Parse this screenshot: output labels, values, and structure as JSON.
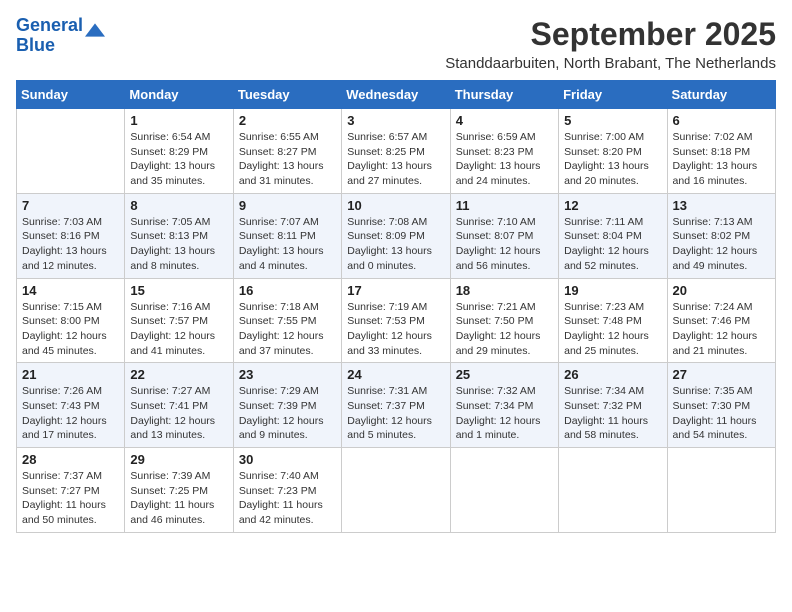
{
  "header": {
    "logo_line1": "General",
    "logo_line2": "Blue",
    "month_title": "September 2025",
    "subtitle": "Standdaarbuiten, North Brabant, The Netherlands"
  },
  "weekdays": [
    "Sunday",
    "Monday",
    "Tuesday",
    "Wednesday",
    "Thursday",
    "Friday",
    "Saturday"
  ],
  "weeks": [
    [
      {
        "day": "",
        "info": ""
      },
      {
        "day": "1",
        "info": "Sunrise: 6:54 AM\nSunset: 8:29 PM\nDaylight: 13 hours\nand 35 minutes."
      },
      {
        "day": "2",
        "info": "Sunrise: 6:55 AM\nSunset: 8:27 PM\nDaylight: 13 hours\nand 31 minutes."
      },
      {
        "day": "3",
        "info": "Sunrise: 6:57 AM\nSunset: 8:25 PM\nDaylight: 13 hours\nand 27 minutes."
      },
      {
        "day": "4",
        "info": "Sunrise: 6:59 AM\nSunset: 8:23 PM\nDaylight: 13 hours\nand 24 minutes."
      },
      {
        "day": "5",
        "info": "Sunrise: 7:00 AM\nSunset: 8:20 PM\nDaylight: 13 hours\nand 20 minutes."
      },
      {
        "day": "6",
        "info": "Sunrise: 7:02 AM\nSunset: 8:18 PM\nDaylight: 13 hours\nand 16 minutes."
      }
    ],
    [
      {
        "day": "7",
        "info": "Sunrise: 7:03 AM\nSunset: 8:16 PM\nDaylight: 13 hours\nand 12 minutes."
      },
      {
        "day": "8",
        "info": "Sunrise: 7:05 AM\nSunset: 8:13 PM\nDaylight: 13 hours\nand 8 minutes."
      },
      {
        "day": "9",
        "info": "Sunrise: 7:07 AM\nSunset: 8:11 PM\nDaylight: 13 hours\nand 4 minutes."
      },
      {
        "day": "10",
        "info": "Sunrise: 7:08 AM\nSunset: 8:09 PM\nDaylight: 13 hours\nand 0 minutes."
      },
      {
        "day": "11",
        "info": "Sunrise: 7:10 AM\nSunset: 8:07 PM\nDaylight: 12 hours\nand 56 minutes."
      },
      {
        "day": "12",
        "info": "Sunrise: 7:11 AM\nSunset: 8:04 PM\nDaylight: 12 hours\nand 52 minutes."
      },
      {
        "day": "13",
        "info": "Sunrise: 7:13 AM\nSunset: 8:02 PM\nDaylight: 12 hours\nand 49 minutes."
      }
    ],
    [
      {
        "day": "14",
        "info": "Sunrise: 7:15 AM\nSunset: 8:00 PM\nDaylight: 12 hours\nand 45 minutes."
      },
      {
        "day": "15",
        "info": "Sunrise: 7:16 AM\nSunset: 7:57 PM\nDaylight: 12 hours\nand 41 minutes."
      },
      {
        "day": "16",
        "info": "Sunrise: 7:18 AM\nSunset: 7:55 PM\nDaylight: 12 hours\nand 37 minutes."
      },
      {
        "day": "17",
        "info": "Sunrise: 7:19 AM\nSunset: 7:53 PM\nDaylight: 12 hours\nand 33 minutes."
      },
      {
        "day": "18",
        "info": "Sunrise: 7:21 AM\nSunset: 7:50 PM\nDaylight: 12 hours\nand 29 minutes."
      },
      {
        "day": "19",
        "info": "Sunrise: 7:23 AM\nSunset: 7:48 PM\nDaylight: 12 hours\nand 25 minutes."
      },
      {
        "day": "20",
        "info": "Sunrise: 7:24 AM\nSunset: 7:46 PM\nDaylight: 12 hours\nand 21 minutes."
      }
    ],
    [
      {
        "day": "21",
        "info": "Sunrise: 7:26 AM\nSunset: 7:43 PM\nDaylight: 12 hours\nand 17 minutes."
      },
      {
        "day": "22",
        "info": "Sunrise: 7:27 AM\nSunset: 7:41 PM\nDaylight: 12 hours\nand 13 minutes."
      },
      {
        "day": "23",
        "info": "Sunrise: 7:29 AM\nSunset: 7:39 PM\nDaylight: 12 hours\nand 9 minutes."
      },
      {
        "day": "24",
        "info": "Sunrise: 7:31 AM\nSunset: 7:37 PM\nDaylight: 12 hours\nand 5 minutes."
      },
      {
        "day": "25",
        "info": "Sunrise: 7:32 AM\nSunset: 7:34 PM\nDaylight: 12 hours\nand 1 minute."
      },
      {
        "day": "26",
        "info": "Sunrise: 7:34 AM\nSunset: 7:32 PM\nDaylight: 11 hours\nand 58 minutes."
      },
      {
        "day": "27",
        "info": "Sunrise: 7:35 AM\nSunset: 7:30 PM\nDaylight: 11 hours\nand 54 minutes."
      }
    ],
    [
      {
        "day": "28",
        "info": "Sunrise: 7:37 AM\nSunset: 7:27 PM\nDaylight: 11 hours\nand 50 minutes."
      },
      {
        "day": "29",
        "info": "Sunrise: 7:39 AM\nSunset: 7:25 PM\nDaylight: 11 hours\nand 46 minutes."
      },
      {
        "day": "30",
        "info": "Sunrise: 7:40 AM\nSunset: 7:23 PM\nDaylight: 11 hours\nand 42 minutes."
      },
      {
        "day": "",
        "info": ""
      },
      {
        "day": "",
        "info": ""
      },
      {
        "day": "",
        "info": ""
      },
      {
        "day": "",
        "info": ""
      }
    ]
  ]
}
